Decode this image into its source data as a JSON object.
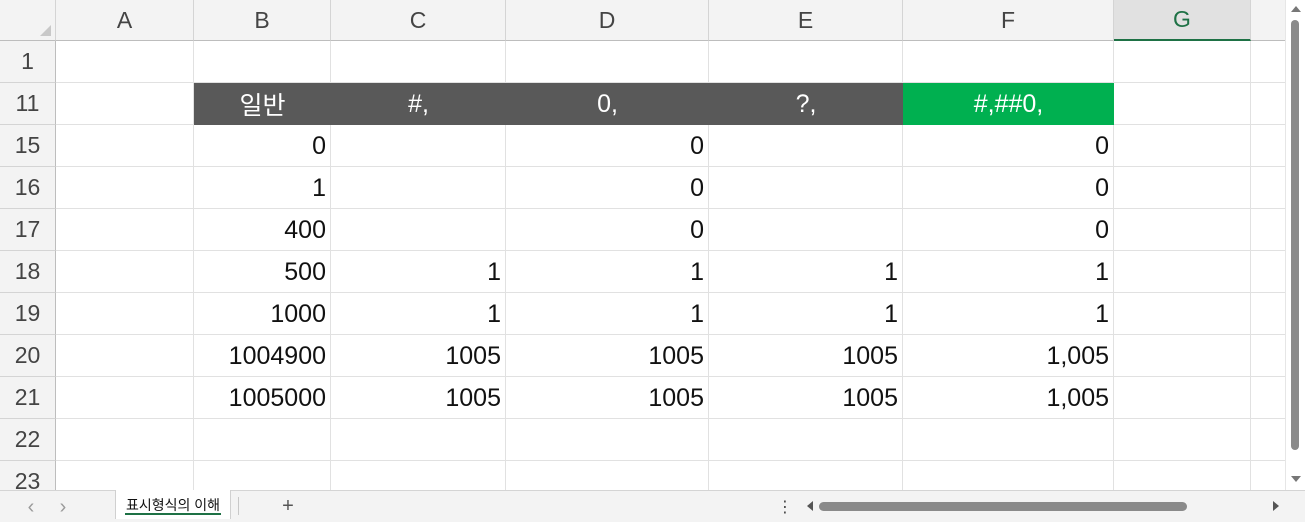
{
  "columns": [
    "A",
    "B",
    "C",
    "D",
    "E",
    "F",
    "G"
  ],
  "selected_column": "G",
  "rows": [
    "1",
    "11",
    "15",
    "16",
    "17",
    "18",
    "19",
    "20",
    "21",
    "22",
    "23"
  ],
  "header_row": {
    "row": "11",
    "labels": [
      "일반",
      "#,",
      "0,",
      "?,",
      "#,##0,"
    ],
    "colors": {
      "dark": "#595959",
      "green": "#00b050"
    }
  },
  "data_rows": [
    {
      "row": "15",
      "values": [
        "0",
        "",
        "0",
        "",
        "0"
      ]
    },
    {
      "row": "16",
      "values": [
        "1",
        "",
        "0",
        "",
        "0"
      ]
    },
    {
      "row": "17",
      "values": [
        "400",
        "",
        "0",
        "",
        "0"
      ]
    },
    {
      "row": "18",
      "values": [
        "500",
        "1",
        "1",
        "1",
        "1"
      ]
    },
    {
      "row": "19",
      "values": [
        "1000",
        "1",
        "1",
        "1",
        "1"
      ]
    },
    {
      "row": "20",
      "values": [
        "1004900",
        "1005",
        "1005",
        "1005",
        "1,005"
      ]
    },
    {
      "row": "21",
      "values": [
        "1005000",
        "1005",
        "1005",
        "1005",
        "1,005"
      ]
    }
  ],
  "sheet_tabs": [
    {
      "label": "표시형식의 이해",
      "active": true
    }
  ],
  "nav": {
    "prev": "‹",
    "next": "›",
    "add": "+",
    "more": "⋮"
  },
  "accent_color": "#1e7145"
}
